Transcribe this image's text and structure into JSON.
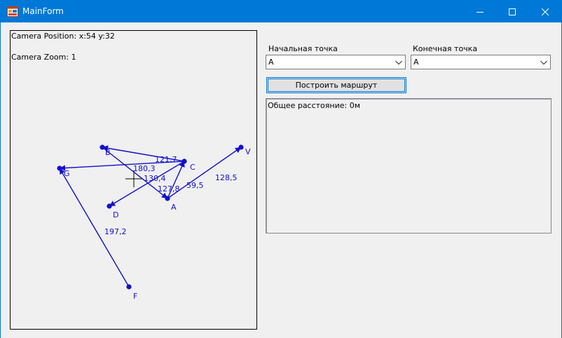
{
  "window": {
    "title": "MainForm",
    "accent_color": "#0078d7",
    "controls": {
      "minimize_icon": "minimize-icon",
      "maximize_icon": "maximize-icon",
      "close_icon": "close-icon"
    }
  },
  "canvas": {
    "camera_position": "Camera Position: x:54 y:32",
    "camera_zoom": "Camera Zoom: 1",
    "graph_color": "#1010cc",
    "nodes": [
      {
        "id": "B",
        "label": "B"
      },
      {
        "id": "C",
        "label": "C"
      },
      {
        "id": "G",
        "label": "G"
      },
      {
        "id": "V",
        "label": "V"
      },
      {
        "id": "D",
        "label": "D"
      },
      {
        "id": "A",
        "label": "A"
      },
      {
        "id": "F",
        "label": "F"
      }
    ],
    "edges": [
      {
        "from": "C",
        "to": "B",
        "weight": "121,7"
      },
      {
        "from": "C",
        "to": "G",
        "weight": "180,3"
      },
      {
        "from": "B",
        "to": "A",
        "weight": "130,4"
      },
      {
        "from": "C",
        "to": "D",
        "weight": "127,8"
      },
      {
        "from": "A",
        "to": "C",
        "weight": "59,5"
      },
      {
        "from": "A",
        "to": "V",
        "weight": "128,5"
      },
      {
        "from": "F",
        "to": "G",
        "weight": "197,2"
      }
    ]
  },
  "controls": {
    "start_label": "Начальная точка",
    "start_value": "A",
    "end_label": "Конечная точка",
    "end_value": "A",
    "build_button": "Построить маршрут",
    "output_text": "Общее расстояние: 0м"
  }
}
